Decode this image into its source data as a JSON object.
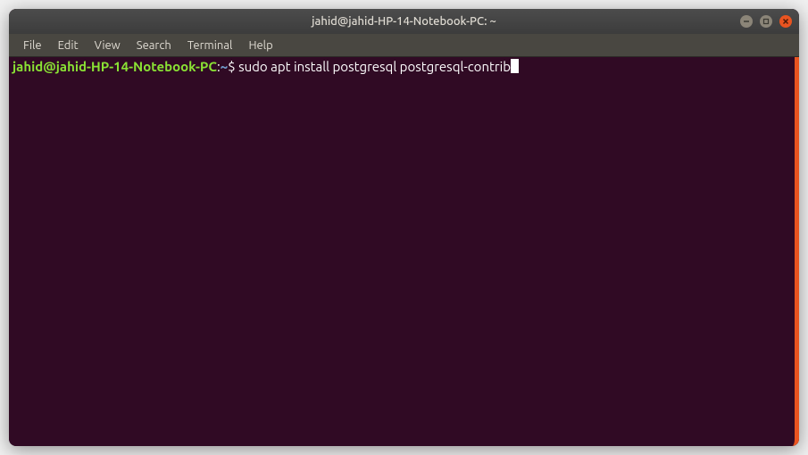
{
  "titlebar": {
    "title": "jahid@jahid-HP-14-Notebook-PC: ~"
  },
  "menubar": {
    "items": [
      {
        "label": "File"
      },
      {
        "label": "Edit"
      },
      {
        "label": "View"
      },
      {
        "label": "Search"
      },
      {
        "label": "Terminal"
      },
      {
        "label": "Help"
      }
    ]
  },
  "terminal": {
    "prompt": {
      "user_host": "jahid@jahid-HP-14-Notebook-PC",
      "colon": ":",
      "path": "~",
      "dollar": "$ "
    },
    "command": "sudo apt install postgresql postgresql-contrib"
  },
  "colors": {
    "terminal_bg": "#300a24",
    "accent": "#e95420",
    "prompt_green": "#8ae234",
    "prompt_blue": "#729fcf",
    "text": "#ffffff"
  }
}
